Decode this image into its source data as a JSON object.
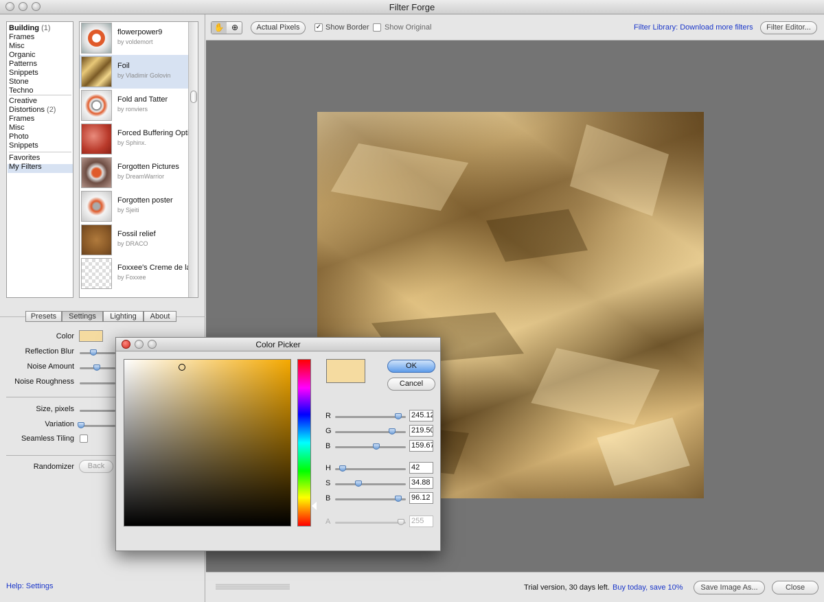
{
  "window": {
    "title": "Filter Forge"
  },
  "categories": {
    "group1": [
      {
        "label": "Building",
        "count": "(1)",
        "bold": true
      },
      {
        "label": "Frames"
      },
      {
        "label": "Misc"
      },
      {
        "label": "Organic"
      },
      {
        "label": "Patterns"
      },
      {
        "label": "Snippets"
      },
      {
        "label": "Stone"
      },
      {
        "label": "Techno"
      }
    ],
    "group2": [
      {
        "label": "Creative"
      },
      {
        "label": "Distortions",
        "count": "(2)"
      },
      {
        "label": "Frames"
      },
      {
        "label": "Misc"
      },
      {
        "label": "Photo"
      },
      {
        "label": "Snippets"
      }
    ],
    "group3": [
      {
        "label": "Favorites"
      },
      {
        "label": "My Filters",
        "selected": true
      }
    ]
  },
  "filters": [
    {
      "name": "flowerpower9",
      "author": "by voldemort"
    },
    {
      "name": "Foil",
      "author": "by Vladimir Golovin",
      "selected": true
    },
    {
      "name": "Fold and Tatter",
      "author": "by ronviers"
    },
    {
      "name": "Forced Buffering Opti",
      "author": "by Sphinx."
    },
    {
      "name": "Forgotten Pictures",
      "author": "by DreamWarrior"
    },
    {
      "name": "Forgotten poster",
      "author": "by Sjeiti"
    },
    {
      "name": "Fossil relief",
      "author": "by DRACO"
    },
    {
      "name": "Foxxee's Creme de la",
      "author": "by Foxxee"
    }
  ],
  "tabs": [
    "Presets",
    "Settings",
    "Lighting",
    "About"
  ],
  "settings": {
    "color_label": "Color",
    "color_value": "#f5dba0",
    "reflection_blur": "Reflection Blur",
    "noise_amount": "Noise Amount",
    "noise_roughness": "Noise Roughness",
    "size_pixels": "Size, pixels",
    "variation": "Variation",
    "seamless_tiling": "Seamless Tiling",
    "randomizer": "Randomizer",
    "back": "Back"
  },
  "help_link": "Help: Settings",
  "toolbar": {
    "actual_pixels": "Actual Pixels",
    "show_border": "Show Border",
    "show_original": "Show Original",
    "library_link": "Filter Library: Download more filters",
    "filter_editor": "Filter Editor..."
  },
  "bottom": {
    "trial": "Trial version, 30 days left.",
    "buy": "Buy today, save 10%",
    "save": "Save Image As...",
    "close": "Close"
  },
  "color_picker": {
    "title": "Color Picker",
    "ok": "OK",
    "cancel": "Cancel",
    "swatch": "#f5dba0",
    "fields": [
      {
        "label": "R",
        "value": "245.12",
        "fraction": 0.961
      },
      {
        "label": "G",
        "value": "219.50",
        "fraction": 0.861
      },
      {
        "label": "B",
        "value": "159.67",
        "fraction": 0.626
      },
      {
        "label": "H",
        "value": "42",
        "fraction": 0.117
      },
      {
        "label": "S",
        "value": "34.88",
        "fraction": 0.349
      },
      {
        "label": "B",
        "value": "96.12",
        "fraction": 0.961
      },
      {
        "label": "A",
        "value": "255",
        "fraction": 1.0,
        "disabled": true
      }
    ]
  },
  "colors": {
    "accent": "#1a36c9",
    "selection": "#d7e2f2"
  }
}
